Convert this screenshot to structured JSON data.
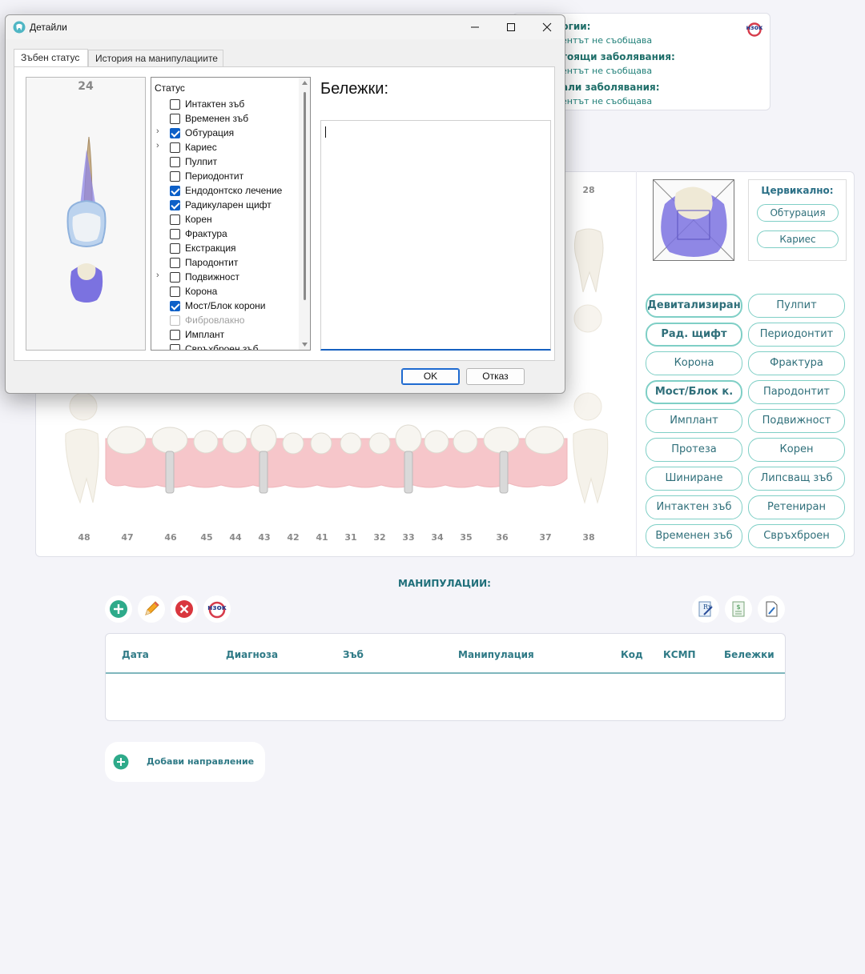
{
  "info_panel": {
    "rows": [
      {
        "heading": "ргии:",
        "value": "ентът не съобщава"
      },
      {
        "heading": "тоящи заболявания:",
        "value": "ентът не съобщава"
      },
      {
        "heading": "али заболявания:",
        "value": "ентът не съобщава"
      }
    ]
  },
  "teeth_chart": {
    "upper_visible_number": "28",
    "lower_numbers": [
      "48",
      "47",
      "46",
      "45",
      "44",
      "43",
      "42",
      "41",
      "31",
      "32",
      "33",
      "34",
      "35",
      "36",
      "37",
      "38"
    ]
  },
  "cervical": {
    "title": "Цервикално:",
    "buttons": [
      "Обтурация",
      "Кариес"
    ]
  },
  "status_buttons": [
    {
      "label": "Девитализиран",
      "bold": true
    },
    {
      "label": "Пулпит",
      "bold": false
    },
    {
      "label": "Рад. щифт",
      "bold": true
    },
    {
      "label": "Периодонтит",
      "bold": false
    },
    {
      "label": "Корона",
      "bold": false
    },
    {
      "label": "Фрактура",
      "bold": false
    },
    {
      "label": "Мост/Блок к.",
      "bold": true
    },
    {
      "label": "Пародонтит",
      "bold": false
    },
    {
      "label": "Имплант",
      "bold": false
    },
    {
      "label": "Подвижност",
      "bold": false
    },
    {
      "label": "Протеза",
      "bold": false
    },
    {
      "label": "Корен",
      "bold": false
    },
    {
      "label": "Шиниране",
      "bold": false
    },
    {
      "label": "Липсващ зъб",
      "bold": false
    },
    {
      "label": "Интактен зъб",
      "bold": false
    },
    {
      "label": "Ретениран",
      "bold": false
    },
    {
      "label": "Временен зъб",
      "bold": false
    },
    {
      "label": "Свръхброен",
      "bold": false
    }
  ],
  "manipulations": {
    "title": "МАНИПУЛАЦИИ:",
    "columns": [
      "Дата",
      "Диагноза",
      "Зъб",
      "Манипулация",
      "Код",
      "КСМП",
      "Бележки"
    ],
    "rows": []
  },
  "add_referral": {
    "label": "Добави направление"
  },
  "dialog": {
    "title": "Детайли",
    "tabs": [
      "Зъбен статус",
      "История на манипулациите"
    ],
    "active_tab": 0,
    "tooth_number": "24",
    "status_header": "Статус",
    "statuses": [
      {
        "label": "Интактен зъб",
        "checked": false,
        "expandable": false,
        "disabled": false
      },
      {
        "label": "Временен зъб",
        "checked": false,
        "expandable": false,
        "disabled": false
      },
      {
        "label": "Обтурация",
        "checked": true,
        "expandable": true,
        "disabled": false
      },
      {
        "label": "Кариес",
        "checked": false,
        "expandable": true,
        "disabled": false
      },
      {
        "label": "Пулпит",
        "checked": false,
        "expandable": false,
        "disabled": false
      },
      {
        "label": "Периодонтит",
        "checked": false,
        "expandable": false,
        "disabled": false
      },
      {
        "label": "Ендодонтско лечение",
        "checked": true,
        "expandable": false,
        "disabled": false
      },
      {
        "label": "Радикуларен щифт",
        "checked": true,
        "expandable": false,
        "disabled": false
      },
      {
        "label": "Корен",
        "checked": false,
        "expandable": false,
        "disabled": false
      },
      {
        "label": "Фрактура",
        "checked": false,
        "expandable": false,
        "disabled": false
      },
      {
        "label": "Екстракция",
        "checked": false,
        "expandable": false,
        "disabled": false
      },
      {
        "label": "Пародонтит",
        "checked": false,
        "expandable": false,
        "disabled": false
      },
      {
        "label": "Подвижност",
        "checked": false,
        "expandable": true,
        "disabled": false
      },
      {
        "label": "Корона",
        "checked": false,
        "expandable": false,
        "disabled": false
      },
      {
        "label": "Мост/Блок корони",
        "checked": true,
        "expandable": false,
        "disabled": false
      },
      {
        "label": "Фибровлакно",
        "checked": false,
        "expandable": false,
        "disabled": true
      },
      {
        "label": "Имплант",
        "checked": false,
        "expandable": false,
        "disabled": false
      },
      {
        "label": "Свръхброен зъб",
        "checked": false,
        "expandable": false,
        "disabled": false
      }
    ],
    "notes_label": "Бележки:",
    "notes_value": "",
    "ok_label": "OK",
    "cancel_label": "Отказ"
  },
  "colors": {
    "accent_teal": "#2f7a86",
    "pill_border": "#7fcfc6",
    "checkbox_blue": "#0d60c8",
    "crown_purple": "#7b72e0",
    "gum_pink": "#f4c4c8"
  }
}
